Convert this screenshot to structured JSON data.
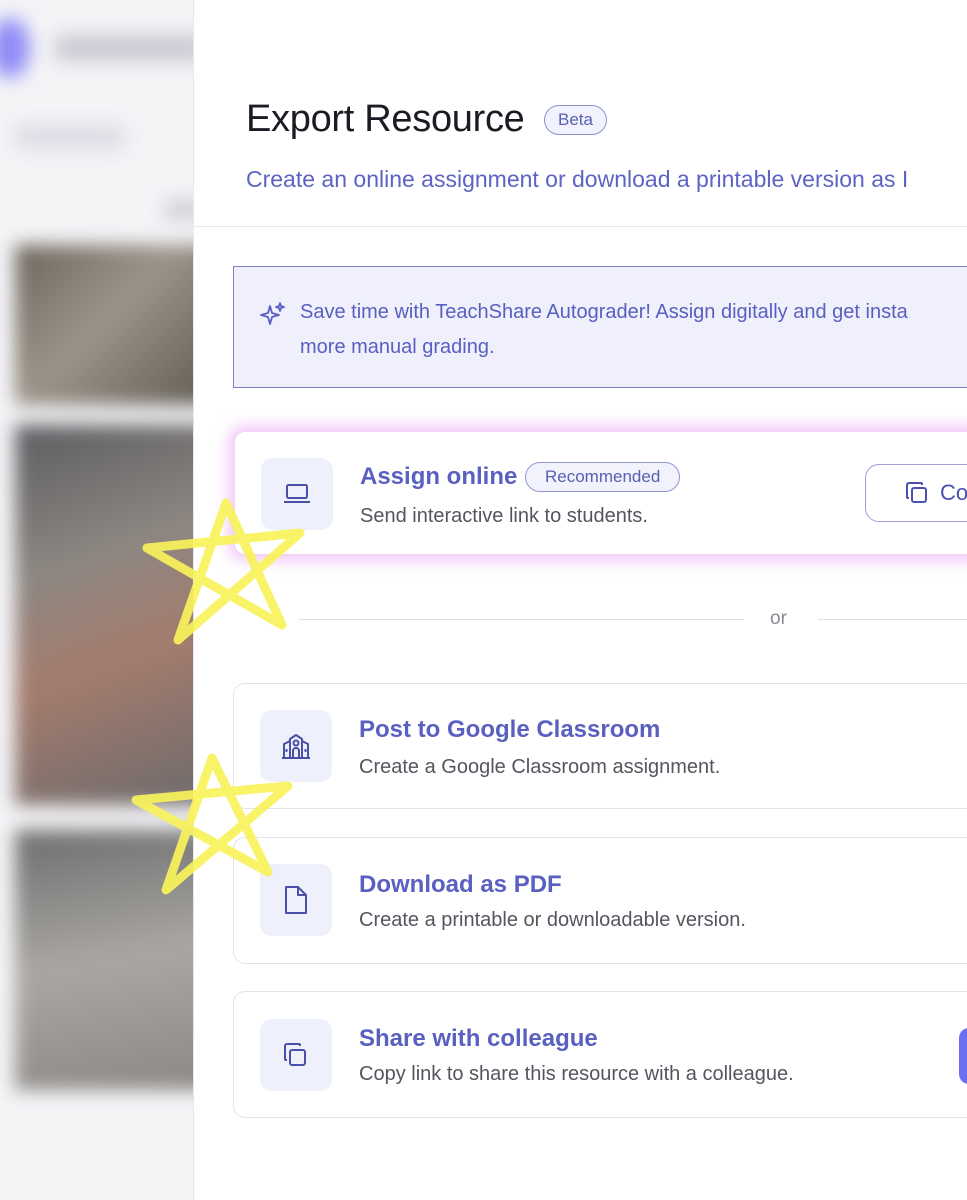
{
  "dialog": {
    "title": "Export Resource",
    "beta_badge": "Beta",
    "subtitle": "Create an online assignment or download a printable version as I"
  },
  "banner": {
    "icon": "sparkle-icon",
    "line1": "Save time with TeachShare Autograder! Assign digitally and get insta",
    "line2": "more manual grading."
  },
  "options": {
    "assign_online": {
      "title": "Assign online",
      "badge": "Recommended",
      "description": "Send interactive link to students.",
      "icon": "laptop-icon",
      "copy_button": "Co"
    },
    "separator": "or",
    "google_classroom": {
      "title": "Post to Google Classroom",
      "description": "Create a Google Classroom assignment.",
      "icon": "school-icon"
    },
    "download_pdf": {
      "title": "Download as PDF",
      "description": "Create a printable or downloadable version.",
      "icon": "file-icon"
    },
    "share_colleague": {
      "title": "Share with colleague",
      "description": "Copy link to share this resource with a colleague.",
      "icon": "copy-icon"
    }
  },
  "colors": {
    "accent": "#5a60c0",
    "banner_bg": "#eff0fc",
    "icon_bg": "#eef0fb",
    "star_annotation": "#f7f25a"
  }
}
